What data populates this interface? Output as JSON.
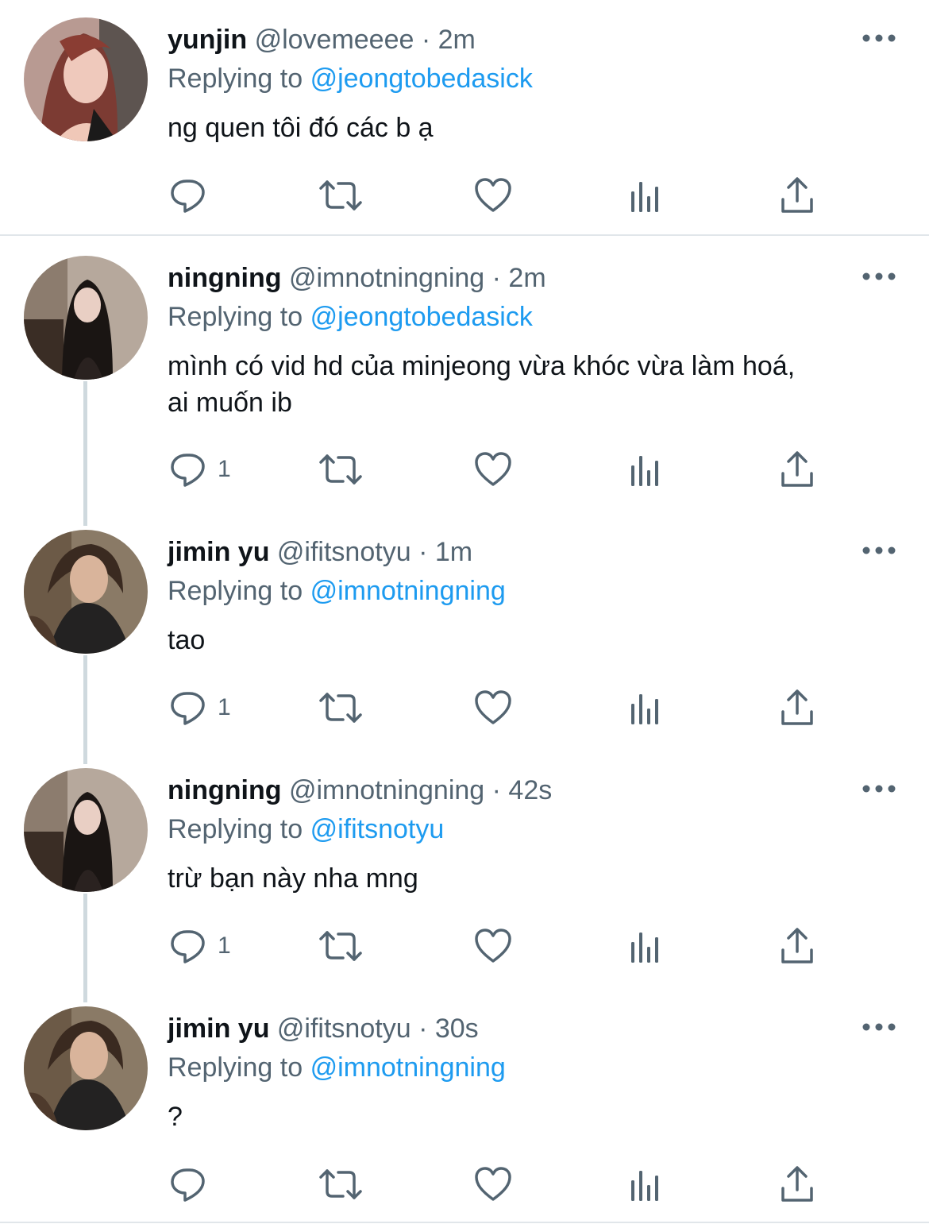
{
  "tweets": [
    {
      "name": "yunjin",
      "handle": "@lovemeeee",
      "time": "· 2m",
      "replying_prefix": "Replying to",
      "mention": "@jeongtobedasick",
      "text_lines": [
        "ng quen tôi đó các b ạ"
      ],
      "reply_count": ""
    },
    {
      "name": "ningning",
      "handle": "@imnotningning",
      "time": "· 2m",
      "replying_prefix": "Replying to",
      "mention": "@jeongtobedasick",
      "text_lines": [
        "mình có vid hd của minjeong vừa khóc vừa làm hoá,",
        "ai muốn ib"
      ],
      "reply_count": "1"
    },
    {
      "name": "jimin yu",
      "handle": "@ifitsnotyu",
      "time": "· 1m",
      "replying_prefix": "Replying to",
      "mention": "@imnotningning",
      "text_lines": [
        "tao"
      ],
      "reply_count": "1"
    },
    {
      "name": "ningning",
      "handle": "@imnotningning",
      "time": "· 42s",
      "replying_prefix": "Replying to",
      "mention": "@ifitsnotyu",
      "text_lines": [
        "trừ bạn này nha mng"
      ],
      "reply_count": "1"
    },
    {
      "name": "jimin yu",
      "handle": "@ifitsnotyu",
      "time": "· 30s",
      "replying_prefix": "Replying to",
      "mention": "@imnotningning",
      "text_lines": [
        "?"
      ],
      "reply_count": ""
    }
  ],
  "colors": {
    "mention": "#1d9bf0",
    "secondary_text": "#536471",
    "primary_text": "#0f1419",
    "icon": "#536471",
    "thread_line": "#cfd9de",
    "divider": "#e1e6ea"
  },
  "icons": [
    "reply-icon",
    "retweet-icon",
    "like-icon",
    "views-icon",
    "share-icon",
    "more-icon"
  ]
}
